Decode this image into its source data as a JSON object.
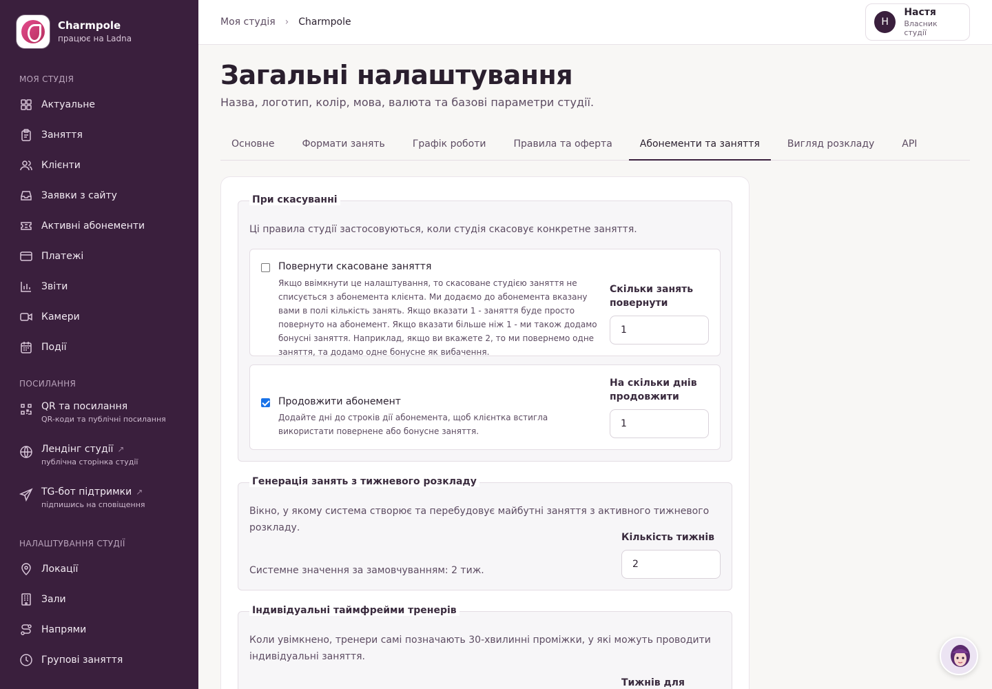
{
  "brand": {
    "name": "Charmpole",
    "sub": "працює на Ladna"
  },
  "sidebar": {
    "section_studio": "МОЯ СТУДІЯ",
    "studio_items": [
      {
        "label": "Актуальне",
        "icon": "dashboard-icon"
      },
      {
        "label": "Заняття",
        "icon": "clipboard-icon"
      },
      {
        "label": "Клієнти",
        "icon": "users-icon"
      },
      {
        "label": "Заявки з сайту",
        "icon": "inbox-icon"
      },
      {
        "label": "Активні абонементи",
        "icon": "ticket-icon"
      },
      {
        "label": "Платежі",
        "icon": "credit-card-icon"
      },
      {
        "label": "Звіти",
        "icon": "bar-chart-icon"
      },
      {
        "label": "Камери",
        "icon": "video-icon"
      },
      {
        "label": "Події",
        "icon": "calendar-icon"
      }
    ],
    "section_links": "ПОСИЛАННЯ",
    "link_items": [
      {
        "label": "QR та посилання",
        "sub": "QR-коди та публічні посилання",
        "icon": "qr-code-icon"
      },
      {
        "label": "Лендінг студії",
        "sub": "публічна сторінка студії",
        "icon": "globe-icon"
      },
      {
        "label": "TG-бот підтримки",
        "sub": "підпишись на сповіщення",
        "icon": "send-icon"
      }
    ],
    "section_settings": "НАЛАШТУВАННЯ СТУДІЇ",
    "settings_items": [
      {
        "label": "Локації",
        "icon": "map-pin-icon"
      },
      {
        "label": "Зали",
        "icon": "building-icon"
      },
      {
        "label": "Напрями",
        "icon": "route-icon"
      },
      {
        "label": "Групові заняття",
        "icon": "clock-icon"
      }
    ]
  },
  "topbar": {
    "crumb1": "Моя студія",
    "crumb2": "Charmpole",
    "user_initial": "Н",
    "user_name": "Настя",
    "user_role": "Власник студії"
  },
  "page": {
    "title": "Загальні налаштування",
    "subtitle": "Назва, логотип, колір, мова, валюта та базові параметри студії."
  },
  "tabs": [
    {
      "label": "Основне",
      "active": false
    },
    {
      "label": "Формати занять",
      "active": false
    },
    {
      "label": "Графік роботи",
      "active": false
    },
    {
      "label": "Правила та оферта",
      "active": false
    },
    {
      "label": "Абонементи та заняття",
      "active": true
    },
    {
      "label": "Вигляд розкладу",
      "active": false
    },
    {
      "label": "API",
      "active": false
    }
  ],
  "cancel_section": {
    "legend": "При скасуванні",
    "desc": "Ці правила студії застосовуються, коли студія скасовує конкретне заняття.",
    "return_option": {
      "title": "Повернути скасоване заняття",
      "checked": false,
      "desc": "Якщо ввімкнути це налаштування, то скасоване студією заняття не списується з абонемента клієнта. Ми додаємо до абонемента вказану вами в полі кількість занять. Якщо вказати 1 - заняття буде просто повернуто на абонемент. Якщо вказати більше ніж 1 - ми також додамо бонусні заняття. Наприклад, якщо ви вкажете 2, то ми повернемо одне заняття, та додамо одне бонусне як вибачення.",
      "field_label": "Скільки занять повернути",
      "value": "1"
    },
    "extend_option": {
      "title": "Продовжити абонемент",
      "checked": true,
      "desc": "Додайте дні до строків дії абонемента, щоб клієнтка встигла використати повернене або бонусне заняття.",
      "field_label": "На скільки днів продовжити",
      "value": "1"
    }
  },
  "generation_section": {
    "legend": "Генерація занять з тижневого розкладу",
    "desc": "Вікно, у якому система створює та перебудовує майбутні заняття з активного тижневого розкладу.",
    "default_note": "Системне значення за замовчуванням: 2 тиж.",
    "field_label": "Кількість тижнів",
    "value": "2"
  },
  "trainer_section": {
    "legend": "Індивідуальні таймфрейми тренерів",
    "desc": "Коли увімкнено, тренери самі позначають 30-хвилинні проміжки, у які можуть проводити індивідуальні заняття.",
    "field_label": "Тижнів для"
  },
  "colors": {
    "sidebar_bg": "#3a1f3d",
    "accent": "#3a1f3d",
    "checkbox": "#1a73e8"
  }
}
